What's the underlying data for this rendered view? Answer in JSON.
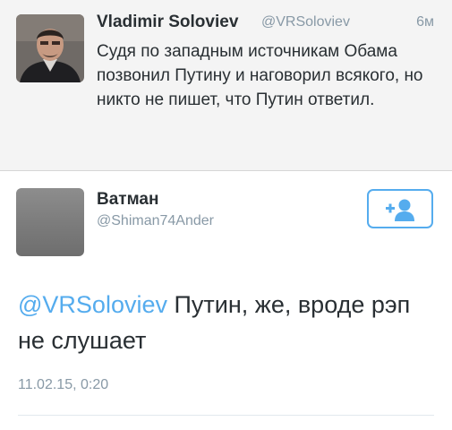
{
  "tweet_original": {
    "author_name": "Vladimir Soloviev",
    "author_handle": "@VRSoloviev",
    "time_ago": "6м",
    "text": "Судя по западным источникам Обама позвонил Путину и наговорил всякого, но никто не пишет, что Путин ответил."
  },
  "tweet_reply": {
    "author_name": "Ватман",
    "author_handle": "@Shiman74Ander",
    "mention": "@VRSoloviev",
    "text": " Путин, же, вроде рэп не слушает",
    "date": "11.02.15, 0:20"
  },
  "follow_button": {
    "icon": "add-user-icon"
  },
  "colors": {
    "accent": "#55acee",
    "secondary_text": "#8899a6",
    "primary_text": "#292f33",
    "top_background": "#f4f4f4"
  }
}
